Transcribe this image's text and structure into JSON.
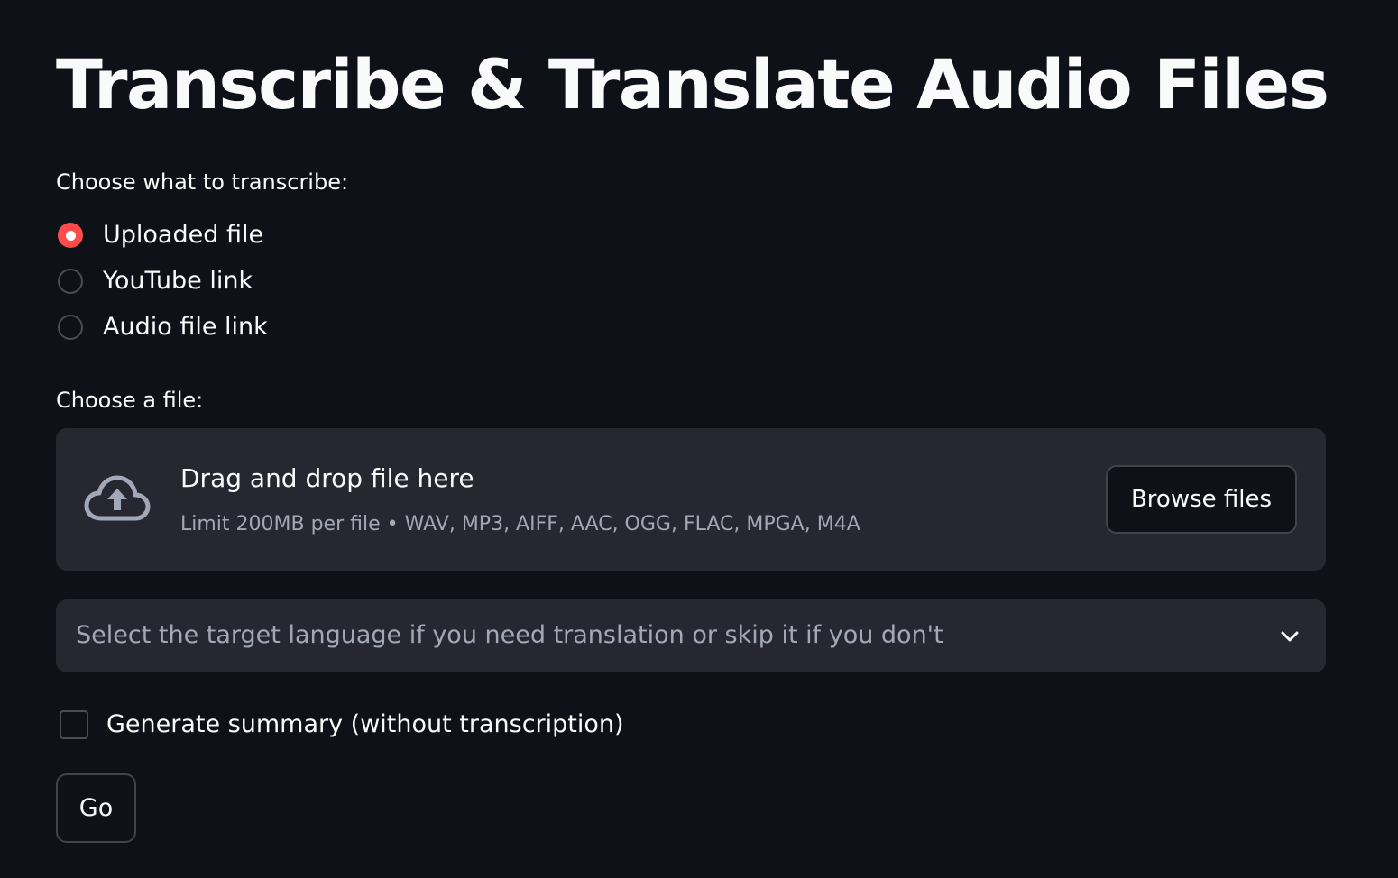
{
  "page": {
    "title": "Transcribe & Translate Audio Files"
  },
  "source": {
    "label": "Choose what to transcribe:",
    "options": [
      {
        "label": "Uploaded file",
        "selected": true
      },
      {
        "label": "YouTube link",
        "selected": false
      },
      {
        "label": "Audio file link",
        "selected": false
      }
    ]
  },
  "uploader": {
    "label": "Choose a file:",
    "drop_text": "Drag and drop file here",
    "limit_text": "Limit 200MB per file • WAV, MP3, AIFF, AAC, OGG, FLAC, MPGA, M4A",
    "browse_label": "Browse files",
    "icon": "cloud-upload-icon"
  },
  "language_select": {
    "placeholder": "Select the target language if you need translation or skip it if you don't",
    "icon": "chevron-down-icon"
  },
  "summary_checkbox": {
    "label": "Generate summary (without transcription)",
    "checked": false
  },
  "actions": {
    "go_label": "Go"
  },
  "colors": {
    "background": "#0e1117",
    "surface": "#262730",
    "accent": "#ff4b4b",
    "text": "#fafafa",
    "muted_text": "#a3a8b8"
  }
}
